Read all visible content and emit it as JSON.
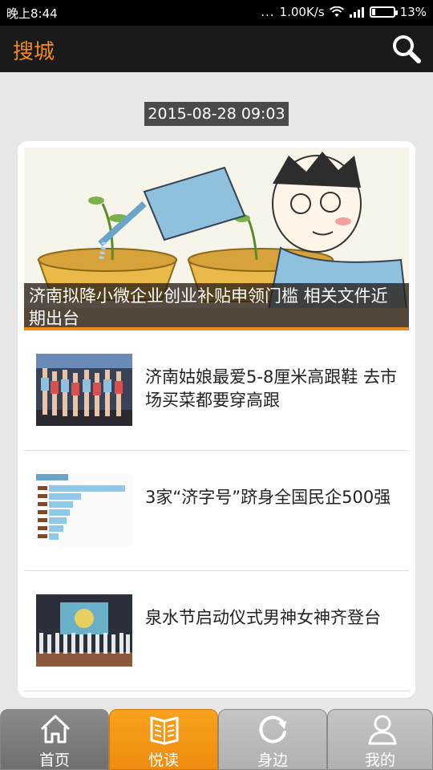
{
  "status_bar": {
    "time": "晚上8:44",
    "dots": "...",
    "speed": "1.00K/s",
    "battery": "13%"
  },
  "app_bar": {
    "title": "搜城"
  },
  "feed": {
    "date": "2015-08-28 09:03",
    "hero_title": "济南拟降小微企业创业补贴申领门槛 相关文件近期出台",
    "items": [
      {
        "title": "济南姑娘最爱5-8厘米高跟鞋 去市场买菜都要穿高跟"
      },
      {
        "title": "3家“济字号”跻身全国民企500强"
      },
      {
        "title": "泉水节启动仪式男神女神齐登台"
      }
    ]
  },
  "bottom_nav": {
    "tabs": [
      {
        "label": "首页",
        "icon": "home-icon"
      },
      {
        "label": "悦读",
        "icon": "book-icon"
      },
      {
        "label": "身边",
        "icon": "refresh-icon"
      },
      {
        "label": "我的",
        "icon": "person-icon"
      }
    ],
    "active_index": 1
  },
  "colors": {
    "accent": "#f28a1a",
    "app_bar": "#1a1a1a",
    "background": "#e7e7e7"
  }
}
